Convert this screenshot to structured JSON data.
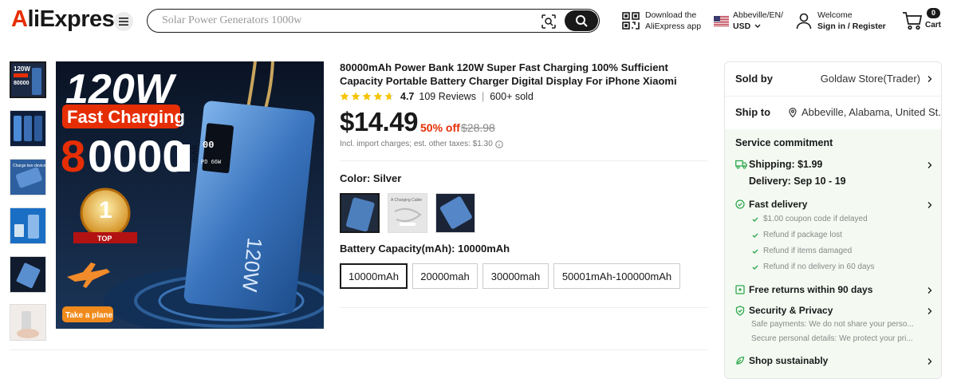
{
  "header": {
    "logo": "AliExpress",
    "search_placeholder": "Solar Power Generators 1000w",
    "app_line1": "Download the",
    "app_line2": "AliExpress app",
    "locale_line1": "Abbeville/EN/",
    "locale_line2": "USD",
    "welcome": "Welcome",
    "signin": "Sign in / Register",
    "cart_count": "0",
    "cart_label": "Cart"
  },
  "gallery": {
    "main_headline": "120W",
    "main_banner": "Fast Charging",
    "main_capacity": "80000",
    "main_unit": "mAh",
    "badge_num": "1",
    "badge_text": "TOP",
    "plane_text": "Take a plane",
    "device_label": "120W",
    "display_top": "00",
    "display_bottom": "PD 66W"
  },
  "product": {
    "title": "80000mAh Power Bank 120W Super Fast Charging 100% Sufficient Capacity Portable Battery Charger Digital Display For iPhone Xiaomi",
    "rating": "4.7",
    "reviews": "109 Reviews",
    "sold": "600+ sold",
    "price": "$14.49",
    "discount": "50% off",
    "original_price": "$28.98",
    "tax_note": "Incl. import charges; est. other taxes: $1.30",
    "color_label": "Color: Silver",
    "capacity_label": "Battery Capacity(mAh): 10000mAh",
    "capacities": [
      "10000mAh",
      "20000mah",
      "30000mah",
      "50001mAh-100000mAh"
    ],
    "accent": "#e62e04"
  },
  "panel": {
    "sold_by_label": "Sold by",
    "store": "Goldaw Store(Trader)",
    "ship_to_label": "Ship to",
    "ship_to": "Abbeville, Alabama, United St...",
    "service_title": "Service commitment",
    "shipping": "Shipping: $1.99",
    "delivery": "Delivery: Sep 10 - 19",
    "fast_delivery": "Fast delivery",
    "fast_items": [
      "$1.00 coupon code if delayed",
      "Refund if package lost",
      "Refund if items damaged",
      "Refund if no delivery in 60 days"
    ],
    "free_returns": "Free returns within 90 days",
    "security": "Security & Privacy",
    "security_items": [
      "Safe payments: We do not share your perso...",
      "Secure personal details: We protect your pri..."
    ],
    "sustain": "Shop sustainably",
    "green": "#2fa94e"
  }
}
